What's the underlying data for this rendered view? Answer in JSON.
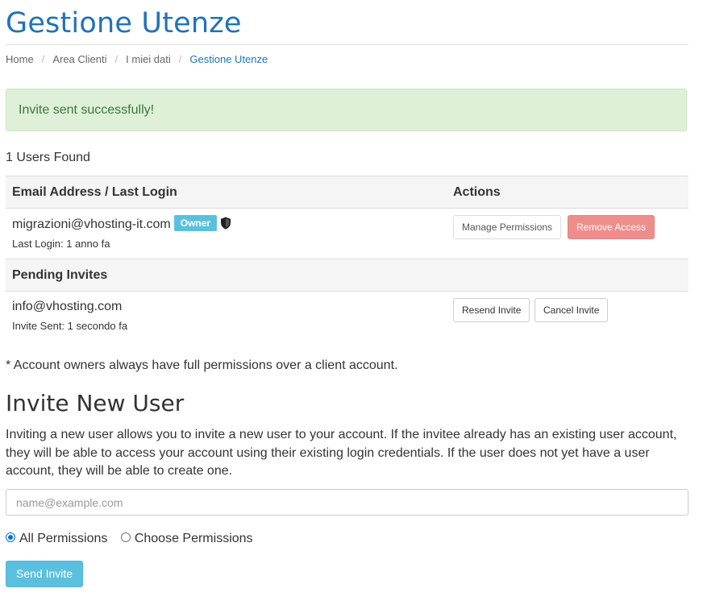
{
  "header": {
    "title": "Gestione Utenze"
  },
  "breadcrumb": [
    "Home",
    "Area Clienti",
    "I miei dati",
    "Gestione Utenze"
  ],
  "alert": {
    "message": "Invite sent successfully!",
    "color": "#3c763d"
  },
  "users_found": "1 Users Found",
  "table": {
    "col_email": "Email Address / Last Login",
    "col_actions": "Actions",
    "user": {
      "email": "migrazioni@vhosting-it.com",
      "badge": "Owner",
      "icon": "shield-icon",
      "last_login": "Last Login: 1 anno fa",
      "manage_label": "Manage Permissions",
      "remove_label": "Remove Access"
    },
    "pending_header": "Pending Invites",
    "invite": {
      "email": "info@vhosting.com",
      "sent": "Invite Sent: 1 secondo fa",
      "resend_label": "Resend Invite",
      "cancel_label": "Cancel Invite"
    }
  },
  "footnote": "* Account owners always have full permissions over a client account.",
  "invite_section": {
    "title": "Invite New User",
    "description": "Inviting a new user allows you to invite a new user to your account. If the invitee already has an existing user account, they will be able to access your account using their existing login credentials. If the user does not yet have a user account, they will be able to create one.",
    "email_placeholder": "name@example.com",
    "email_value": "",
    "option_all": "All Permissions",
    "option_choose": "Choose Permissions",
    "selected": "All Permissions",
    "submit_label": "Send Invite"
  },
  "colors": {
    "accent": "#1f73b7",
    "info": "#5bc0de",
    "danger": "#ee8e8c",
    "success_bg": "#dff0d8"
  }
}
